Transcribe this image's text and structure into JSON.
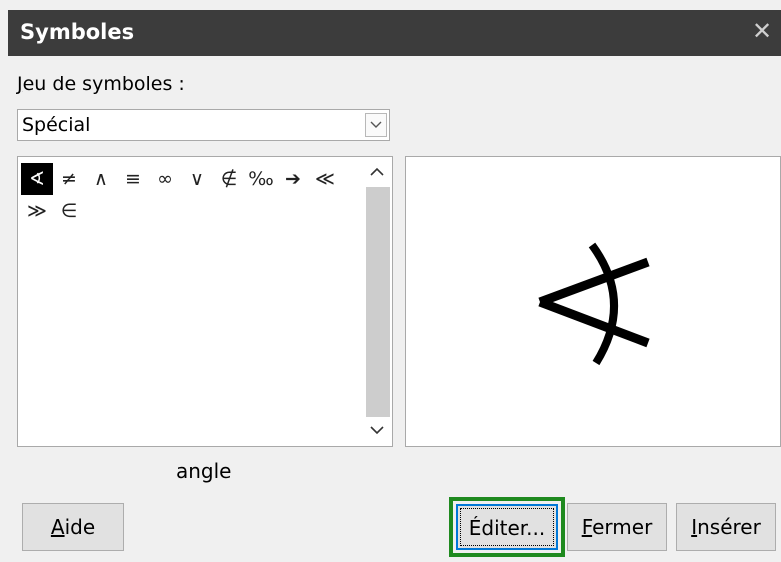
{
  "window": {
    "title": "Symboles",
    "close_icon": "close-icon"
  },
  "symbol_set": {
    "label_mnemonic": "J",
    "label_rest": "eu de symboles :",
    "selected": "Spécial"
  },
  "symbols": [
    "∢",
    "≠",
    "∧",
    "≡",
    "∞",
    "∨",
    "∉",
    "‰",
    "➔",
    "≪",
    "≫",
    "∈"
  ],
  "selected_symbol": {
    "index": 0,
    "glyph": "∢",
    "name": "angle"
  },
  "buttons": {
    "help_mn": "A",
    "help_rest": "ide",
    "edit": "Éditer...",
    "close_mn": "F",
    "close_rest": "ermer",
    "insert_mn": "I",
    "insert_rest": "nsérer"
  },
  "colors": {
    "titlebar": "#3c3c3c",
    "focus_highlight": "#1f8a1f",
    "default_button_border": "#0078d7"
  }
}
